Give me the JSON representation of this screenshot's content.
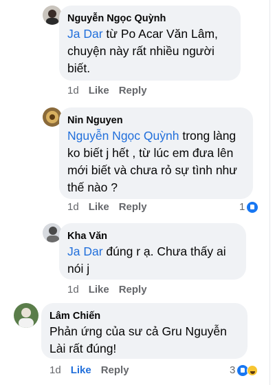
{
  "comments": [
    {
      "author": "Nguyễn Ngọc Quỳnh",
      "mention": "Ja Dar",
      "text": " từ Po Acar Văn Lâm, chuyện này rất nhiều người biết.",
      "time": "1d",
      "like": "Like",
      "reply": "Reply"
    },
    {
      "author": "Nin Nguyen",
      "mention": "Nguyễn Ngọc Quỳnh",
      "text": " trong làng ko biết j hết , từ lúc em đưa lên mới biết và chưa rỏ sự tình như thế nào ?",
      "time": "1d",
      "like": "Like",
      "reply": "Reply",
      "reaction_count": "1",
      "reaction_icons": [
        "like-icon"
      ]
    },
    {
      "author": "Kha Văn",
      "mention": "Ja Dar",
      "text": " đúng r ạ. Chưa thấy ai nói j",
      "time": "1d",
      "like": "Like",
      "reply": "Reply"
    },
    {
      "author": "Lâm Chiến",
      "text": "Phản ứng của sư cả Gru Nguyễn Lài rất đúng!",
      "time": "1d",
      "like": "Like",
      "like_active": true,
      "reply": "Reply",
      "reaction_count": "3",
      "reaction_icons": [
        "like-icon",
        "haha-icon"
      ]
    }
  ],
  "colors": {
    "bubble": "#f0f2f5",
    "mention": "#216fdb",
    "meta": "#65676b",
    "like_active": "#216fdb"
  }
}
